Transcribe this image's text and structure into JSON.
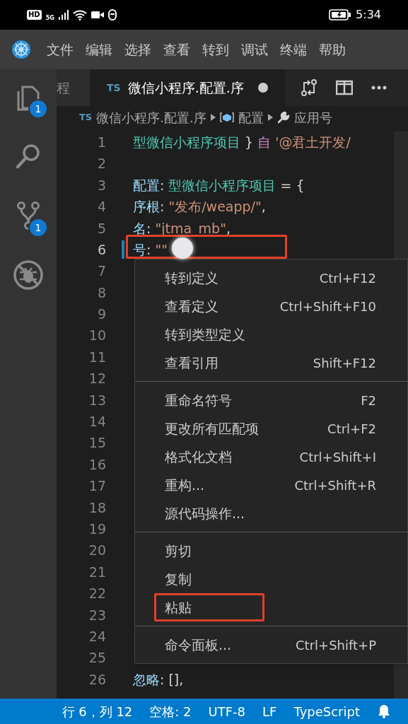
{
  "phone_status": {
    "time": "5:34",
    "network": "5G",
    "hd": "HD"
  },
  "menu_bar": [
    "文件",
    "编辑",
    "选择",
    "查看",
    "转到",
    "调试",
    "终端",
    "帮助"
  ],
  "activity_bar": [
    {
      "kind": "files",
      "badge": "1",
      "selected": false
    },
    {
      "kind": "search",
      "selected": false
    },
    {
      "kind": "source-control",
      "badge": "1",
      "selected": false
    },
    {
      "kind": "debug",
      "selected": false
    }
  ],
  "tabs": [
    {
      "label": "程",
      "selected": false
    },
    {
      "badge": "TS",
      "label": "微信小程序.配置.序",
      "modified": true,
      "selected": true
    }
  ],
  "breadcrumb": {
    "badge": "TS",
    "items": [
      {
        "kind": "file",
        "label": "微信小程序.配置.序"
      },
      {
        "kind": "object",
        "label": "配置"
      },
      {
        "kind": "property",
        "label": "应用号"
      }
    ]
  },
  "lines": [
    {
      "number": "1",
      "current": false,
      "tokens": [
        {
          "kind": "type",
          "text": "型微信小程序项目"
        },
        {
          "kind": "punct",
          "text": " } "
        },
        {
          "kind": "keyword",
          "text": "自"
        },
        {
          "kind": "string",
          "text": " '@君土开发/"
        }
      ]
    },
    {
      "number": "2",
      "current": false
    },
    {
      "number": "3",
      "current": false,
      "tokens": [
        {
          "kind": "key",
          "text": "配置"
        },
        {
          "kind": "punct",
          "text": ": "
        },
        {
          "kind": "type",
          "text": "型微信小程序项目"
        },
        {
          "kind": "punct",
          "text": " = {"
        }
      ]
    },
    {
      "number": "4",
      "current": false,
      "tokens": [
        {
          "kind": "key",
          "text": "序根"
        },
        {
          "kind": "punct",
          "text": ": "
        },
        {
          "kind": "string",
          "text": "\"发布/weapp/\""
        },
        {
          "kind": "punct",
          "text": ","
        }
      ]
    },
    {
      "number": "5",
      "current": false,
      "tokens": [
        {
          "kind": "key",
          "text": "名"
        },
        {
          "kind": "punct",
          "text": ": "
        },
        {
          "kind": "string",
          "text": "\"jtma_mb\""
        },
        {
          "kind": "punct",
          "text": ","
        }
      ]
    },
    {
      "number": "6",
      "current": true,
      "tokens": [
        {
          "kind": "key",
          "text": "号"
        },
        {
          "kind": "punct",
          "text": ": "
        },
        {
          "kind": "string",
          "text": "\"\""
        }
      ]
    },
    {
      "number": "7",
      "current": false
    },
    {
      "number": "8",
      "current": false
    },
    {
      "number": "9",
      "current": false
    },
    {
      "number": "10",
      "current": false
    },
    {
      "number": "11",
      "current": false
    },
    {
      "number": "12",
      "current": false
    },
    {
      "number": "13",
      "current": false
    },
    {
      "number": "14",
      "current": false
    },
    {
      "number": "15",
      "current": false
    },
    {
      "number": "16",
      "current": false
    },
    {
      "number": "17",
      "current": false
    },
    {
      "number": "18",
      "current": false
    },
    {
      "number": "19",
      "current": false
    },
    {
      "number": "20",
      "current": false
    },
    {
      "number": "21",
      "current": false
    },
    {
      "number": "22",
      "current": false
    },
    {
      "number": "23",
      "current": false
    },
    {
      "number": "24",
      "current": false
    },
    {
      "number": "25",
      "current": false
    },
    {
      "number": "26",
      "current": false,
      "tokens": [
        {
          "kind": "key",
          "text": "忽略"
        },
        {
          "kind": "punct",
          "text": ": [],"
        }
      ]
    }
  ],
  "context_menu": [
    [
      {
        "label": "转到定义",
        "shortcut": "Ctrl+F12"
      },
      {
        "label": "查看定义",
        "shortcut": "Ctrl+Shift+F10"
      },
      {
        "label": "转到类型定义"
      },
      {
        "label": "查看引用",
        "shortcut": "Shift+F12"
      }
    ],
    [
      {
        "label": "重命名符号",
        "shortcut": "F2"
      },
      {
        "label": "更改所有匹配项",
        "shortcut": "Ctrl+F2"
      },
      {
        "label": "格式化文档",
        "shortcut": "Ctrl+Shift+I"
      },
      {
        "label": "重构...",
        "shortcut": "Ctrl+Shift+R"
      },
      {
        "label": "源代码操作..."
      }
    ],
    [
      {
        "label": "剪切",
        "highlighted": false
      },
      {
        "label": "复制",
        "highlighted": false
      },
      {
        "label": "粘贴",
        "highlighted": true
      }
    ],
    [
      {
        "label": "命令面板...",
        "shortcut": "Ctrl+Shift+P"
      }
    ]
  ],
  "status_bar": [
    "行 6，列 12",
    "空格: 2",
    "UTF-8",
    "LF",
    "TypeScript"
  ]
}
